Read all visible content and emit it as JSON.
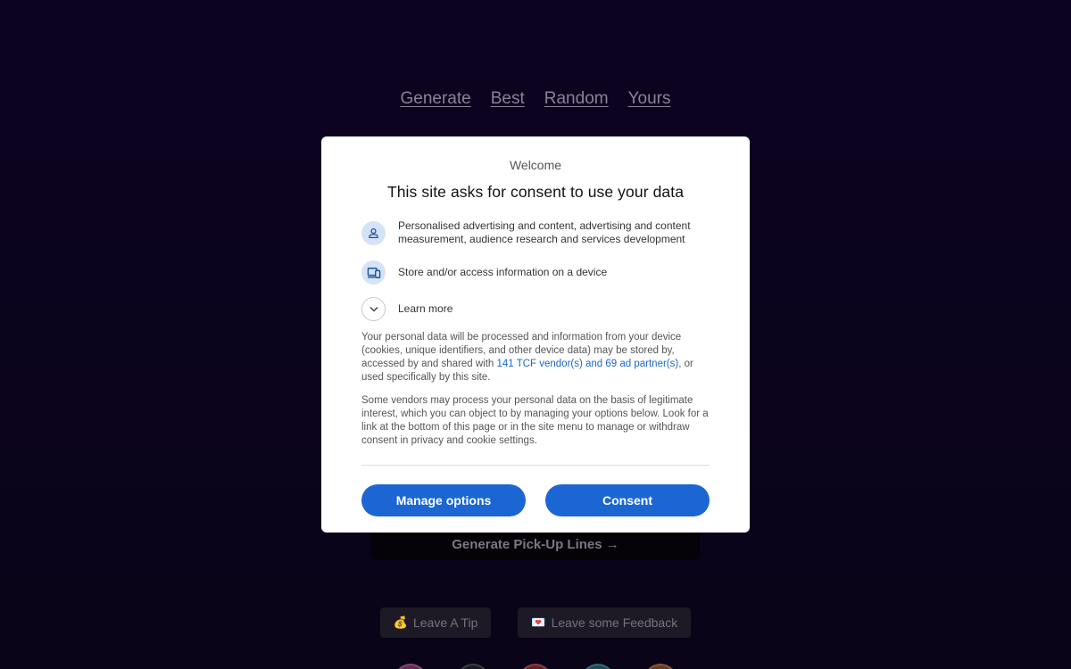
{
  "nav": {
    "items": [
      {
        "label": "Generate"
      },
      {
        "label": "Best"
      },
      {
        "label": "Random"
      },
      {
        "label": "Yours"
      }
    ]
  },
  "page": {
    "generate_label": "Generate Pick-Up Lines →",
    "tip_label": "Leave A Tip",
    "tip_emoji": "💰",
    "feedback_label": "Leave some Feedback",
    "feedback_emoji": "💌"
  },
  "consent": {
    "welcome": "Welcome",
    "title": "This site asks for consent to use your data",
    "purposes": [
      {
        "icon": "person-icon",
        "text": "Personalised advertising and content, advertising and content measurement, audience research and services development"
      },
      {
        "icon": "device-icon",
        "text": "Store and/or access information on a device"
      },
      {
        "icon": "chevron-down-icon",
        "text": "Learn more"
      }
    ],
    "paragraph1_pre": "Your personal data will be processed and information from your device (cookies, unique identifiers, and other device data) may be stored by, accessed by and shared with ",
    "paragraph1_link": "141 TCF vendor(s) and 69 ad partner(s)",
    "paragraph1_post": ", or used specifically by this site.",
    "paragraph2": "Some vendors may process your personal data on the basis of legitimate interest, which you can object to by managing your options below. Look for a link at the bottom of this page or in the site menu to manage or withdraw consent in privacy and cookie settings.",
    "manage_label": "Manage options",
    "consent_label": "Consent",
    "accent_color": "#1b66d3"
  }
}
